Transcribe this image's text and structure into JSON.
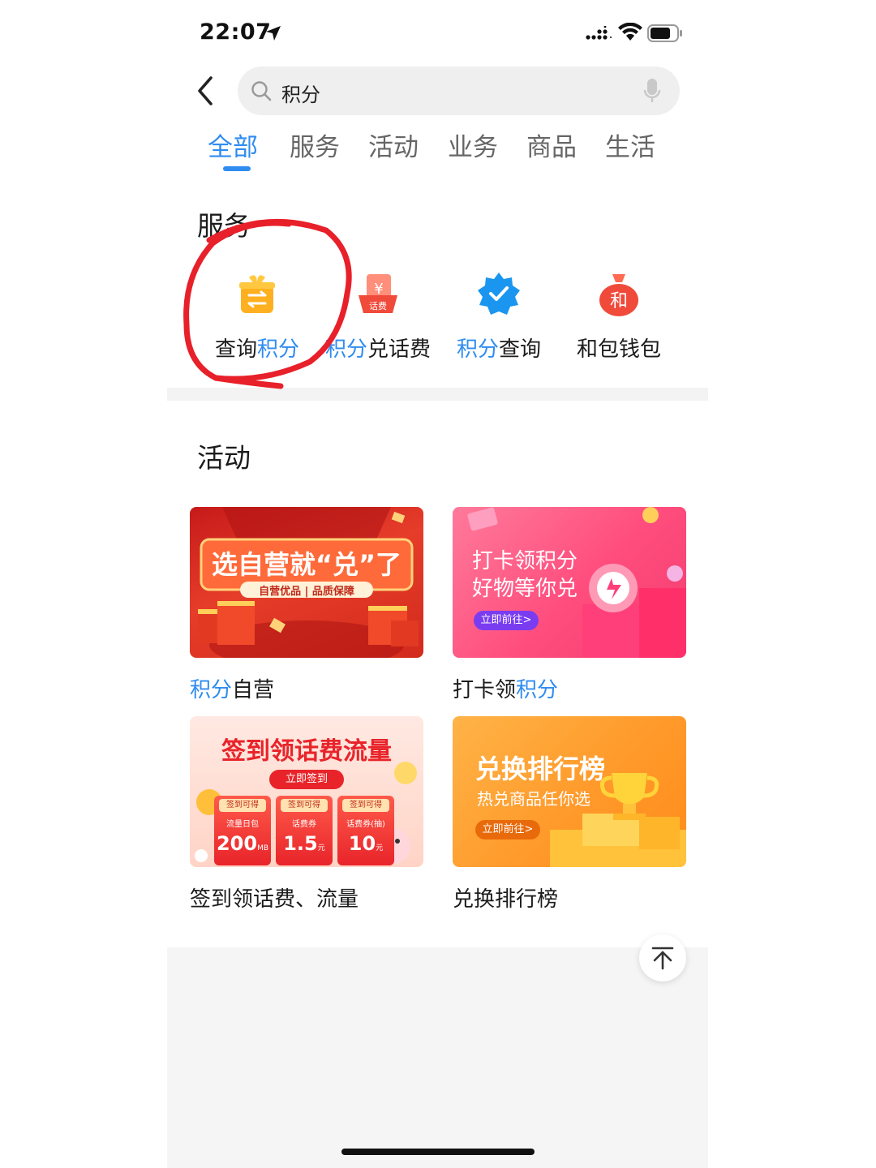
{
  "status": {
    "time": "22:07"
  },
  "search": {
    "query": "积分"
  },
  "tabs": [
    {
      "label": "全部"
    },
    {
      "label": "服务"
    },
    {
      "label": "活动"
    },
    {
      "label": "业务"
    },
    {
      "label": "商品"
    },
    {
      "label": "生活"
    }
  ],
  "active_tab_index": 0,
  "services": {
    "title": "服务",
    "items": [
      {
        "pre": "查询",
        "hl": "积分",
        "post": "",
        "icon": "gift-exchange-icon"
      },
      {
        "pre": "",
        "hl": "积分",
        "post": "兑话费",
        "icon": "phone-bill-icon",
        "badge": "话费"
      },
      {
        "pre": "",
        "hl": "积分",
        "post": "查询",
        "icon": "verified-badge-icon"
      },
      {
        "pre": "和包钱包",
        "hl": "",
        "post": "",
        "icon": "money-bag-icon",
        "badge": "和"
      }
    ]
  },
  "activities": {
    "title": "活动",
    "items": [
      {
        "label_hl": "积分",
        "label_post": "自营",
        "banner": {
          "headline": "选自营就“兑”了",
          "sub": "自营优品 | 品质保障"
        }
      },
      {
        "label_pre": "打卡领",
        "label_hl": "积分",
        "banner": {
          "line1": "打卡领积分",
          "line2": "好物等你兑",
          "cta": "立即前往>"
        }
      },
      {
        "label": "签到领话费、流量",
        "banner": {
          "headline": "签到领话费流量",
          "cta": "立即签到",
          "tickets": [
            {
              "top": "签到可得",
              "name": "流量日包",
              "value": "200",
              "unit": "MB"
            },
            {
              "top": "签到可得",
              "name": "话费券",
              "value": "1.5",
              "unit": "元"
            },
            {
              "top": "签到可得",
              "name": "话费券(抽)",
              "value": "10",
              "unit": "元"
            }
          ]
        }
      },
      {
        "label": "兑换排行榜",
        "banner": {
          "headline": "兑换排行榜",
          "sub": "热兑商品任你选",
          "cta": "立即前往>"
        }
      }
    ]
  },
  "colors": {
    "accent": "#2f8cf0",
    "annotation": "#e8202a"
  }
}
